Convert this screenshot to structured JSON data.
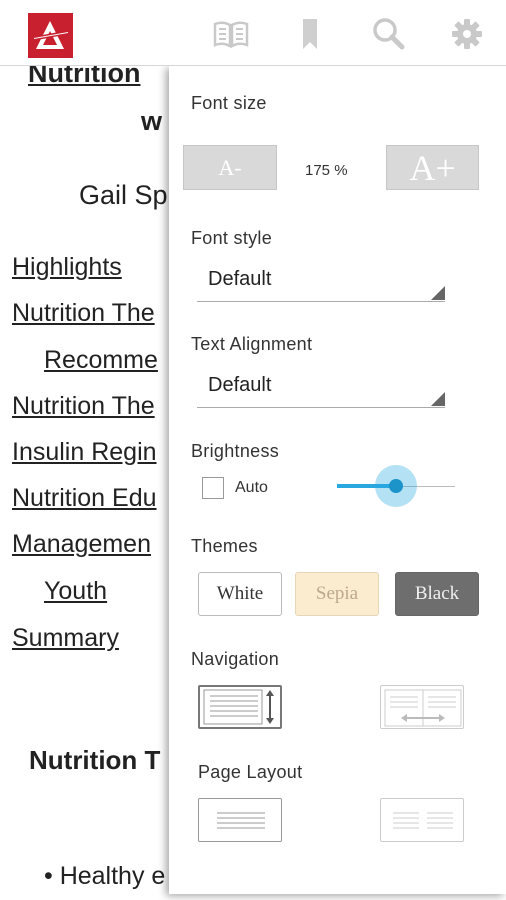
{
  "toolbar": {
    "logo": "app-logo",
    "icons": [
      "book-icon",
      "bookmark-icon",
      "search-icon",
      "gear-icon"
    ]
  },
  "document": {
    "lines": {
      "title_part1": "Nutrition",
      "title_part2": "w",
      "author": "Gail Sp",
      "link1": "Highlights",
      "link2": "Nutrition The",
      "link3": "Recomme",
      "link4": "Nutrition The",
      "link5": "Insulin Regin",
      "link6": "Nutrition Edu",
      "link7": "Managemen",
      "link8": "Youth",
      "link9": "Summary",
      "heading": "Nutrition T",
      "bullet": "• Healthy e"
    }
  },
  "settings": {
    "font_size": {
      "label": "Font size",
      "decrease": "A-",
      "value": "175 %",
      "increase": "A+"
    },
    "font_style": {
      "label": "Font style",
      "selected": "Default"
    },
    "text_alignment": {
      "label": "Text Alignment",
      "selected": "Default"
    },
    "brightness": {
      "label": "Brightness",
      "auto_label": "Auto",
      "auto_checked": false,
      "level": 0.5
    },
    "themes": {
      "label": "Themes",
      "white": "White",
      "sepia": "Sepia",
      "black": "Black",
      "colors": {
        "white_bg": "#ffffff",
        "sepia_bg": "#fbecd0",
        "black_bg": "#6e6e6e"
      }
    },
    "navigation": {
      "label": "Navigation"
    },
    "page_layout": {
      "label": "Page Layout"
    }
  },
  "colors": {
    "brand": "#c8202f",
    "accent": "#29a8e0"
  }
}
